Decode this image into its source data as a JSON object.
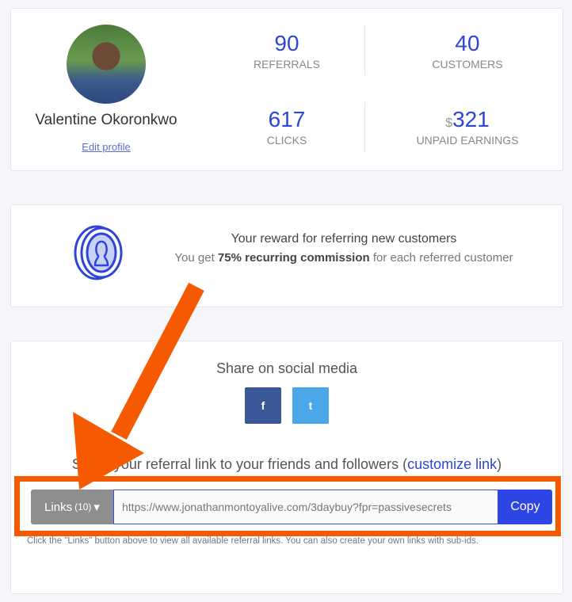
{
  "profile": {
    "name": "Valentine Okoronkwo",
    "edit_label": "Edit profile"
  },
  "stats": [
    {
      "value": "90",
      "label": "REFERRALS"
    },
    {
      "value": "40",
      "label": "CUSTOMERS"
    },
    {
      "value": "617",
      "label": "CLICKS"
    },
    {
      "currency": "$",
      "value": "321",
      "label": "UNPAID EARNINGS"
    }
  ],
  "reward": {
    "title": "Your reward for referring new customers",
    "prefix": "You get ",
    "bold": "75% recurring commission",
    "suffix": " for each referred customer",
    "icon": "coin-user-icon"
  },
  "share": {
    "title": "Share on social media",
    "facebook": "f",
    "twitter": "t",
    "link_text": "Share your referral link to your friends and followers (",
    "customize": "customize link",
    "link_close": ")",
    "links_label": "Links",
    "links_count": "(10)",
    "url": "https://www.jonathanmontoyalive.com/3daybuy?fpr=passivesecrets",
    "copy": "Copy",
    "help": "Click the \"Links\" button above to view all available referral links. You can also create your own links with sub-ids."
  },
  "colors": {
    "accent": "#2e45d6",
    "annotation": "#f55a00"
  }
}
